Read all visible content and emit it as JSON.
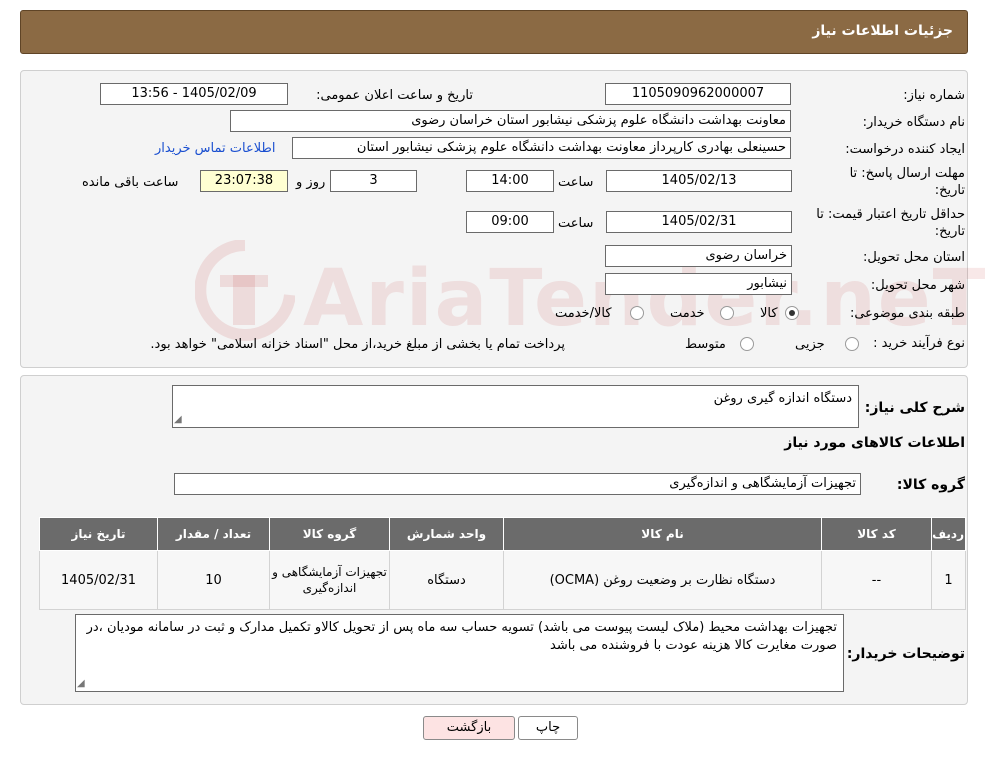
{
  "header": {
    "title": "جزئیات اطلاعات نیاز"
  },
  "fields": {
    "need_number_label": "شماره نیاز:",
    "need_number": "1105090962000007",
    "announce_label": "تاریخ و ساعت اعلان عمومی:",
    "announce_value": "1405/02/09 - 13:56",
    "buyer_org_label": "نام دستگاه خریدار:",
    "buyer_org": "معاونت بهداشت دانشگاه علوم پزشکی نیشابور استان خراسان رضوی",
    "creator_label": "ایجاد کننده درخواست:",
    "creator": "حسینعلی بهادری کارپرداز معاونت بهداشت دانشگاه علوم پزشکی نیشابور استان",
    "contact_link": "اطلاعات تماس خریدار",
    "deadline_label_1": "مهلت ارسال پاسخ: تا",
    "deadline_label_2": "تاریخ:",
    "deadline_date": "1405/02/13",
    "time_label": "ساعت",
    "deadline_time": "14:00",
    "days_value": "3",
    "days_label": "روز و",
    "remaining_time": "23:07:38",
    "remaining_label": "ساعت باقی مانده",
    "validity_label_1": "حداقل تاریخ اعتبار قیمت: تا",
    "validity_label_2": "تاریخ:",
    "validity_date": "1405/02/31",
    "validity_time": "09:00",
    "province_label": "استان محل تحویل:",
    "province": "خراسان رضوی",
    "city_label": "شهر محل تحویل:",
    "city": "نیشابور",
    "category_label": "طبقه بندی موضوعی:",
    "category_options": [
      "کالا",
      "خدمت",
      "کالا/خدمت"
    ],
    "category_selected": "کالا",
    "process_label": "نوع فرآیند خرید :",
    "process_options": [
      "جزیی",
      "متوسط"
    ],
    "process_note": "پرداخت تمام یا بخشی از مبلغ خرید،از محل \"اسناد خزانه اسلامی\" خواهد بود."
  },
  "summary": {
    "label": "شرح کلی نیاز:",
    "value": "دستگاه اندازه گیری روغن",
    "items_heading": "اطلاعات کالاهای مورد نیاز",
    "group_label": "گروه کالا:",
    "group_value": "تجهیزات آزمایشگاهی و اندازه‌گیری"
  },
  "table": {
    "headers": [
      "ردیف",
      "کد کالا",
      "نام کالا",
      "واحد شمارش",
      "گروه کالا",
      "تعداد / مقدار",
      "تاریخ نیاز"
    ],
    "rows": [
      [
        "1",
        "--",
        "دستگاه نظارت بر وضعیت روغن (OCMA)",
        "دستگاه",
        "تجهیزات آزمایشگاهی و اندازه‌گیری",
        "10",
        "1405/02/31"
      ]
    ]
  },
  "notes": {
    "label": "توضیحات خریدار:",
    "value": "تجهیزات بهداشت محیط (ملاک لیست پیوست می باشد) تسویه حساب سه ماه پس از تحویل کالاو تکمیل مدارک و ثبت در سامانه مودیان ،در صورت مغایرت کالا هزینه عودت با فروشنده می باشد"
  },
  "buttons": {
    "print": "چاپ",
    "back": "بازگشت"
  },
  "watermark": {
    "text": "AriaTender.neT"
  },
  "colors": {
    "header_bg": "#8b6a44",
    "table_header_bg": "#6b6b6b",
    "back_button_bg": "#fde3e3",
    "remaining_bg": "#ffffd2"
  }
}
